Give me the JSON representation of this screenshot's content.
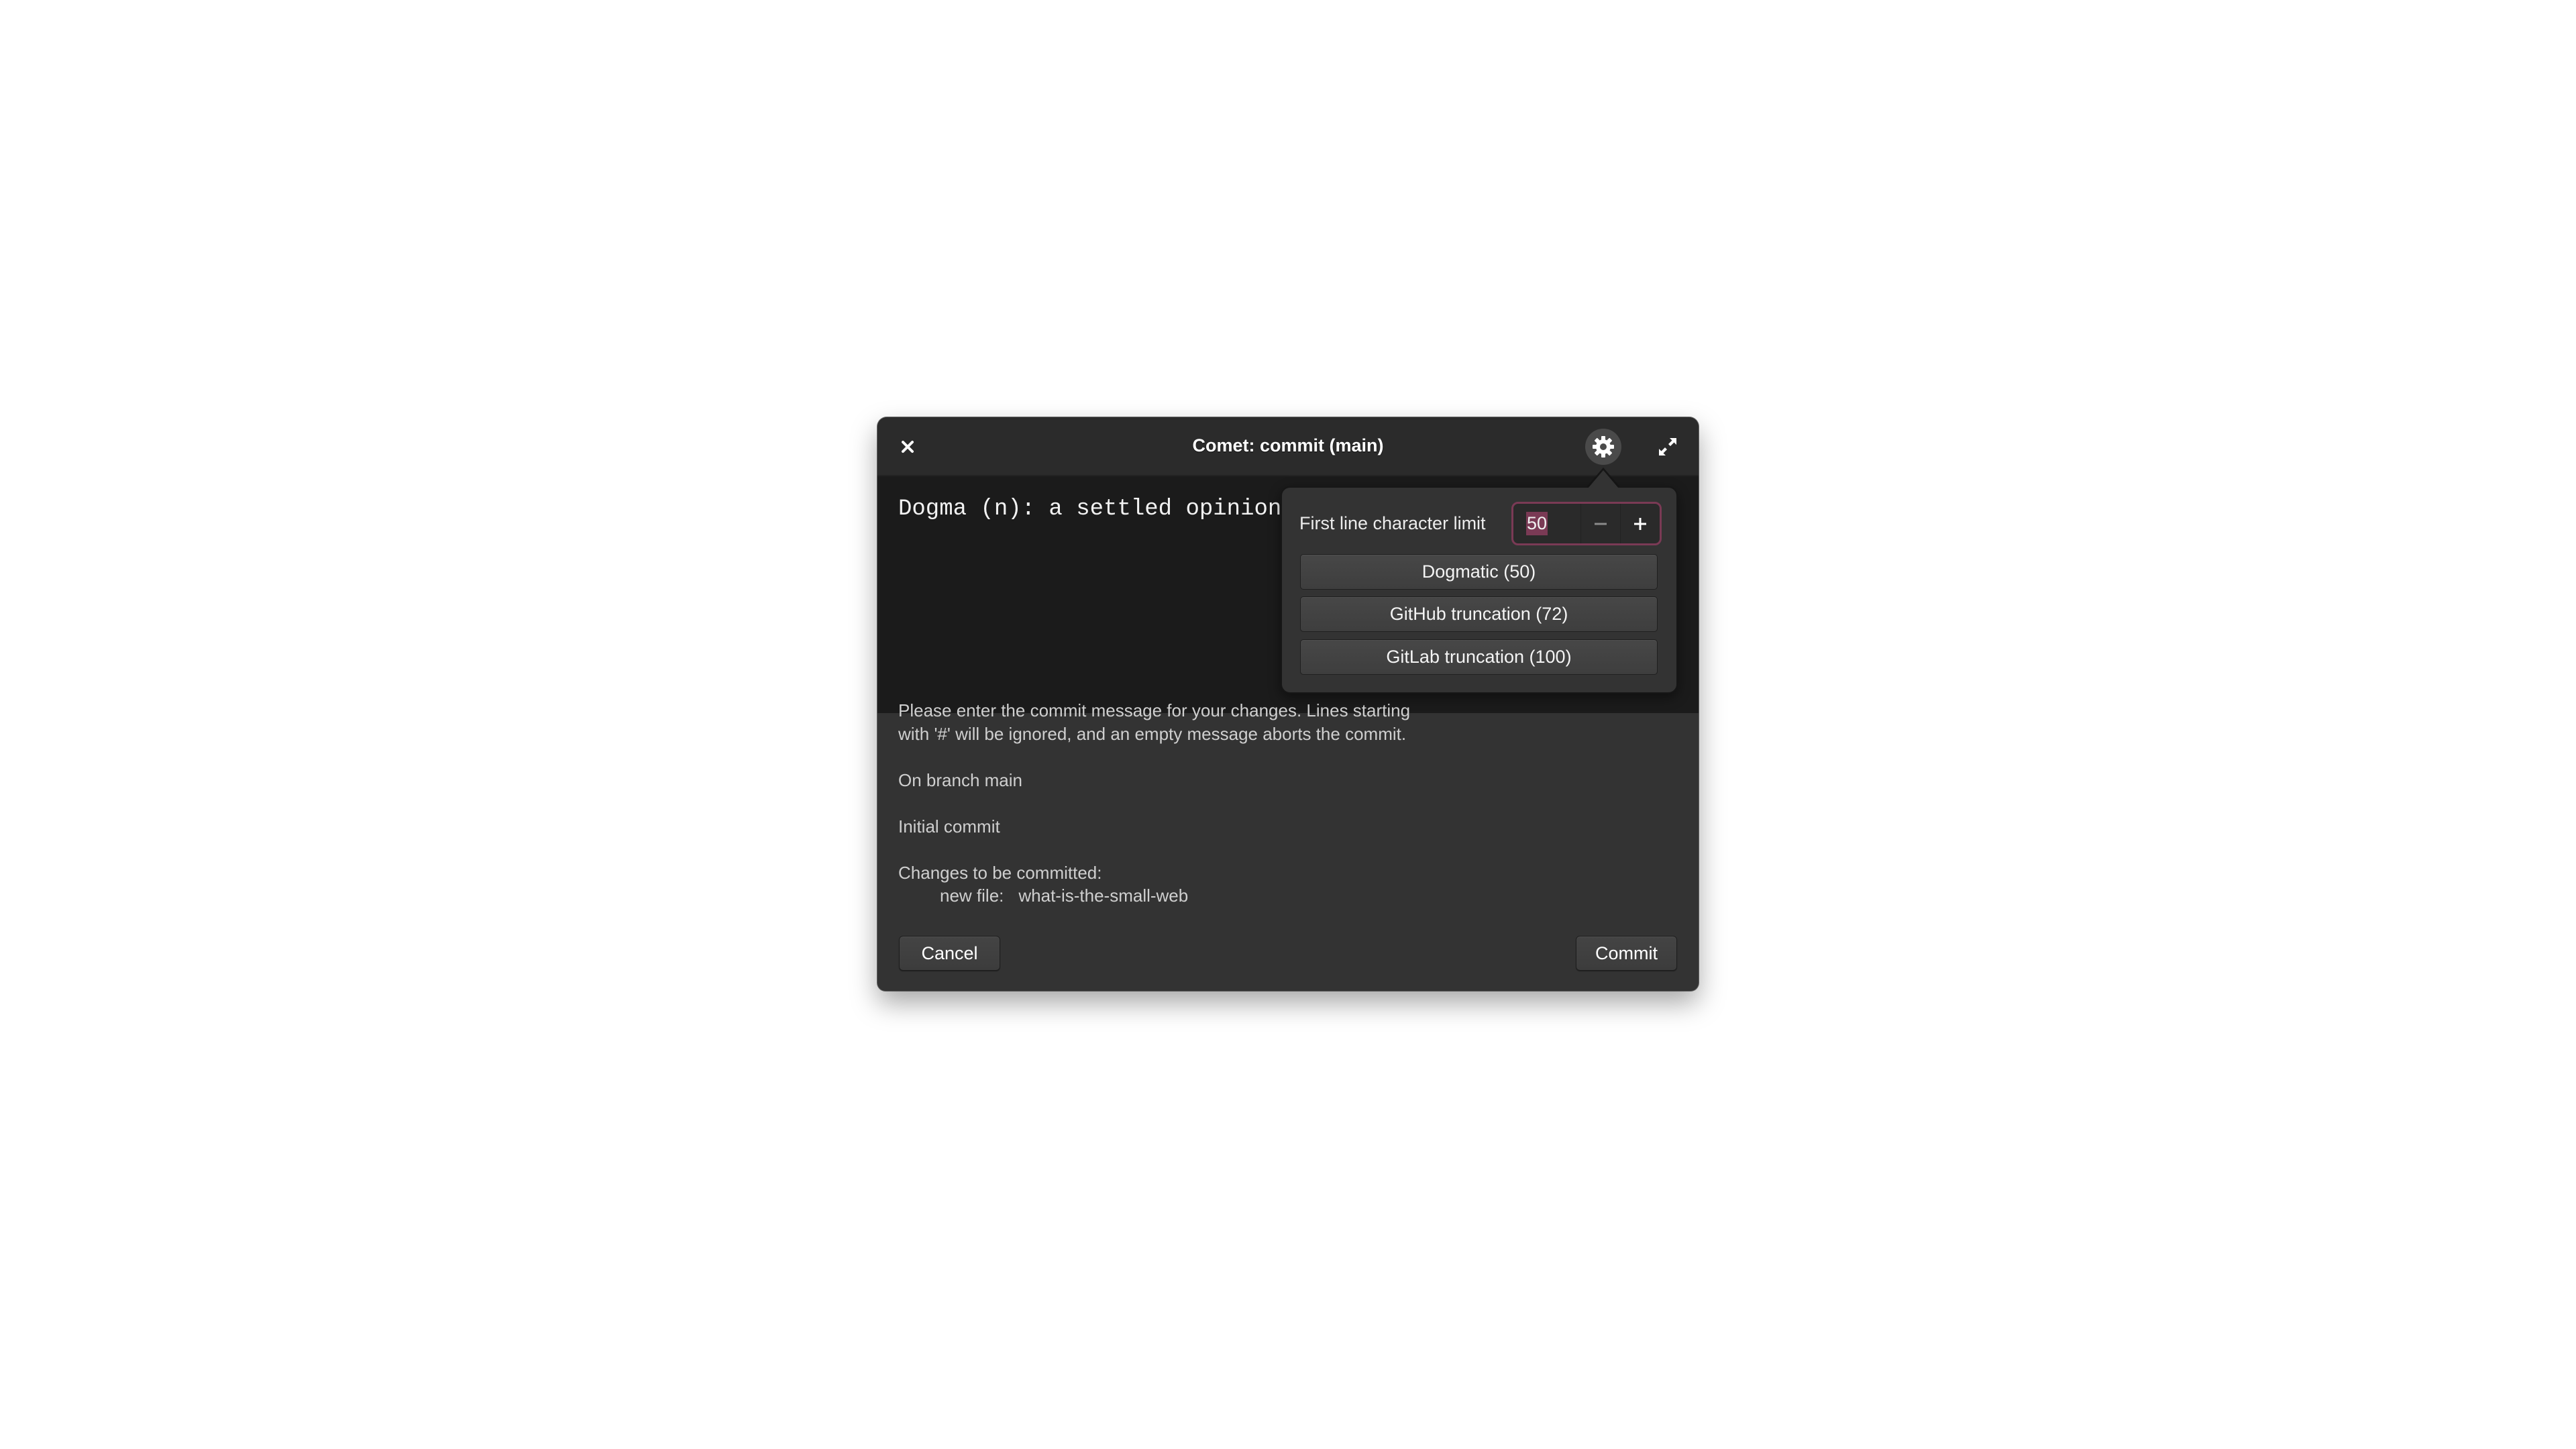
{
  "window": {
    "title": "Comet: commit (main)",
    "close_icon": "close-icon",
    "settings_icon": "gear-icon",
    "expand_icon": "expand-icon"
  },
  "editor": {
    "value": "Dogma (n): a settled opinion"
  },
  "info": {
    "help_line_1": "Please enter the commit message for your changes. Lines starting",
    "help_line_2": "with '#' will be ignored, and an empty message aborts the commit.",
    "branch": "On branch main",
    "initial": "Initial commit",
    "changes_header": "Changes to be committed:",
    "change_kind": "new file:",
    "change_file": "what-is-the-small-web"
  },
  "actions": {
    "cancel_label": "Cancel",
    "commit_label": "Commit"
  },
  "settings_popover": {
    "limit_label": "First line character limit",
    "limit_value": "50",
    "decrement_icon": "minus-icon",
    "increment_icon": "plus-icon",
    "presets": [
      {
        "label": "Dogmatic (50)",
        "value": 50
      },
      {
        "label": "GitHub truncation (72)",
        "value": 72
      },
      {
        "label": "GitLab truncation (100)",
        "value": 100
      }
    ]
  },
  "colors": {
    "accent": "#7a3a55",
    "titlebar": "#2b2b2b",
    "editor_bg": "#1b1b1b",
    "body_bg": "#333333"
  }
}
